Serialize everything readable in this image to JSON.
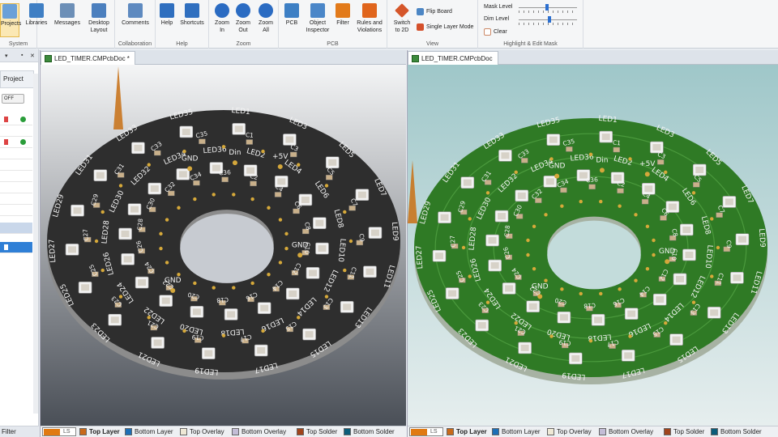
{
  "ribbon": {
    "groups": {
      "system": "System",
      "collaboration": "Collaboration",
      "help": "Help",
      "zoom": "Zoom",
      "pcb": "PCB",
      "view": "View",
      "mask": "Highlight & Edit Mask"
    },
    "buttons": {
      "projects": "Projects",
      "libraries": "Libraries",
      "messages": "Messages",
      "desktop_layout": "Desktop Layout",
      "comments": "Comments",
      "help": "Help",
      "shortcuts": "Shortcuts",
      "zoom_in": "Zoom In",
      "zoom_out": "Zoom Out",
      "zoom_all": "Zoom All",
      "pcb": "PCB",
      "object_inspector": "Object Inspector",
      "filter": "Filter",
      "rules_violations": "Rules and Violations",
      "switch_2d": "Switch to 2D",
      "flip_board": "Flip Board",
      "single_layer_mode": "Single Layer Mode",
      "mask_level": "Mask Level",
      "dim_level": "Dim Level",
      "clear": "Clear"
    },
    "colors": {
      "accent": "#e5b94a",
      "blue": "#2b6fd0"
    }
  },
  "left_panel": {
    "project_label": "Project",
    "toggle_label": "OFF",
    "filter_label": "Filter"
  },
  "editors": [
    {
      "tab": "LED_TIMER.CMPcbDoc *",
      "board_color": "#2e2e2e",
      "bg": "#c6cad0"
    },
    {
      "tab": "LED_TIMER.CMPcbDoc",
      "board_color": "#2f7a25",
      "bg": "#b9d6d9"
    }
  ],
  "layer_bar": {
    "ls": "LS",
    "layers": [
      {
        "name": "Top Layer",
        "color": "#c8691a"
      },
      {
        "name": "Bottom Layer",
        "color": "#1d6fb6"
      },
      {
        "name": "Top Overlay",
        "color": "#efe9d6"
      },
      {
        "name": "Bottom Overlay",
        "color": "#c3bdd6"
      },
      {
        "name": "Top Solder",
        "color": "#a0441c"
      },
      {
        "name": "Bottom Solder",
        "color": "#0c5d7a"
      }
    ]
  },
  "board": {
    "leds": [
      "LED1",
      "LED2",
      "LED3",
      "LED4",
      "LED5",
      "LED6",
      "LED7",
      "LED8",
      "LED9",
      "LED10",
      "LED11",
      "LED12",
      "LED13",
      "LED14",
      "LED15",
      "LED16",
      "LED17",
      "LED18",
      "LED19",
      "LED20",
      "LED21",
      "LED22",
      "LED23",
      "LED24",
      "LED25",
      "LED26",
      "LED27",
      "LED28",
      "LED29",
      "LED30",
      "LED31",
      "LED32",
      "LED33",
      "LED34",
      "LED35",
      "LED36"
    ],
    "caps": [
      "C1",
      "C2",
      "C3",
      "C4",
      "C5",
      "C6",
      "C7",
      "C8",
      "C9",
      "C10",
      "C11",
      "C12",
      "C13",
      "C14",
      "C15",
      "C16",
      "C17",
      "C18",
      "C19",
      "C20",
      "C21",
      "C22",
      "C23",
      "C24",
      "C25",
      "C26",
      "C27",
      "C28",
      "C29",
      "C30",
      "C31",
      "C32",
      "C33",
      "C34",
      "C35",
      "C36"
    ],
    "pads": [
      "GND",
      "Din",
      "+5V",
      "GND",
      "GND"
    ]
  }
}
